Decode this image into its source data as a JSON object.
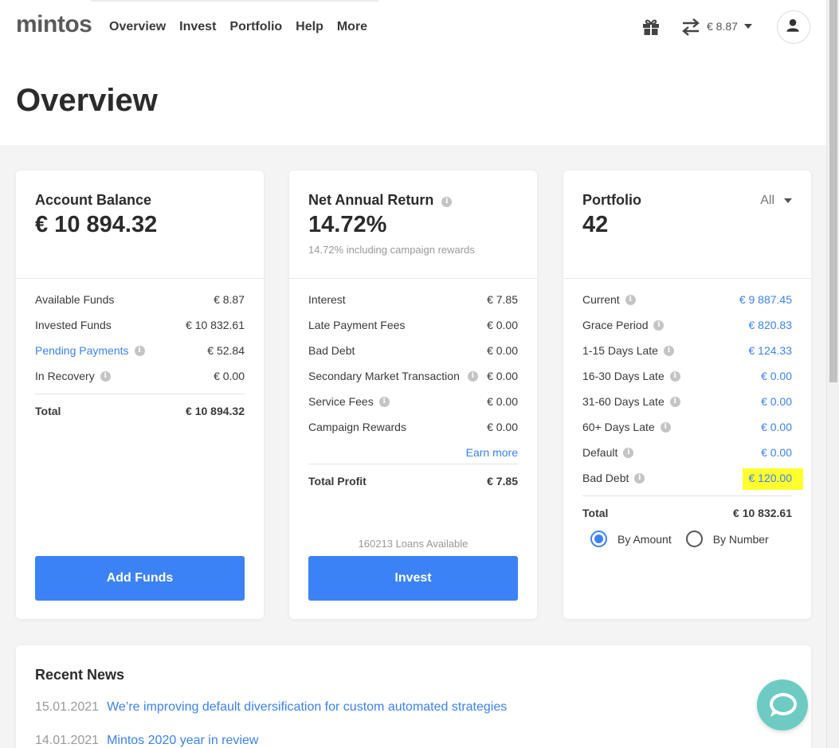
{
  "logo": "mintos",
  "nav": [
    "Overview",
    "Invest",
    "Portfolio",
    "Help",
    "More"
  ],
  "header": {
    "balance": "€ 8.87"
  },
  "page_title": "Overview",
  "account": {
    "title": "Account Balance",
    "value": "€ 10 894.32",
    "rows": [
      {
        "label": "Available Funds",
        "value": "€ 8.87"
      },
      {
        "label": "Invested Funds",
        "value": "€ 10 832.61"
      },
      {
        "label": "Pending Payments",
        "value": "€ 52.84"
      },
      {
        "label": "In Recovery",
        "value": "€ 0.00"
      }
    ],
    "total_label": "Total",
    "total_value": "€ 10 894.32",
    "button": "Add Funds"
  },
  "nar": {
    "title": "Net Annual Return",
    "value": "14.72%",
    "sub": "14.72% including campaign rewards",
    "rows": [
      {
        "label": "Interest",
        "value": "€ 7.85"
      },
      {
        "label": "Late Payment Fees",
        "value": "€ 0.00"
      },
      {
        "label": "Bad Debt",
        "value": "€ 0.00"
      },
      {
        "label": "Secondary Market Transaction",
        "value": "€ 0.00"
      },
      {
        "label": "Service Fees",
        "value": "€ 0.00"
      },
      {
        "label": "Campaign Rewards",
        "value": "€ 0.00"
      }
    ],
    "earn_more": "Earn more",
    "total_label": "Total Profit",
    "total_value": "€ 7.85",
    "loans_available": "160213 Loans Available",
    "button": "Invest"
  },
  "portfolio": {
    "title": "Portfolio",
    "value": "42",
    "filter": "All",
    "rows": [
      {
        "label": "Current",
        "value": "€ 9 887.45"
      },
      {
        "label": "Grace Period",
        "value": "€ 820.83"
      },
      {
        "label": "1-15 Days Late",
        "value": "€ 124.33"
      },
      {
        "label": "16-30 Days Late",
        "value": "€ 0.00"
      },
      {
        "label": "31-60 Days Late",
        "value": "€ 0.00"
      },
      {
        "label": "60+ Days Late",
        "value": "€ 0.00"
      },
      {
        "label": "Default",
        "value": "€ 0.00"
      },
      {
        "label": "Bad Debt",
        "value": "€ 120.00"
      }
    ],
    "total_label": "Total",
    "total_value": "€ 10 832.61",
    "radio_amount": "By Amount",
    "radio_number": "By Number"
  },
  "news": {
    "title": "Recent News",
    "items": [
      {
        "date": "15.01.2021",
        "text": "We’re improving default diversification for custom automated strategies"
      },
      {
        "date": "14.01.2021",
        "text": "Mintos 2020 year in review"
      }
    ]
  },
  "colors": {
    "accent": "#3b82f6",
    "highlight": "#ffff2e",
    "chat": "#6ecbc4"
  }
}
